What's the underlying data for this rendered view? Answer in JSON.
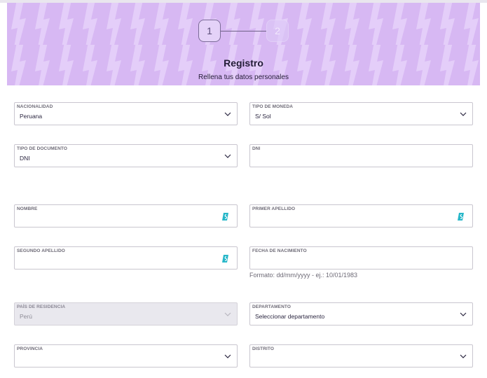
{
  "header": {
    "steps": [
      {
        "number": "1",
        "state": "active"
      },
      {
        "number": "2",
        "state": "inactive"
      }
    ],
    "title": "Registro",
    "subtitle": "Rellena tus datos personales",
    "background_color": "#d7b8f3"
  },
  "form": {
    "nacionalidad": {
      "label": "NACIONALIDAD",
      "value": "Peruana"
    },
    "tipo_moneda": {
      "label": "TIPO DE MONEDA",
      "value": "S/ Sol"
    },
    "tipo_documento": {
      "label": "TIPO DE DOCUMENTO",
      "value": "DNI"
    },
    "dni": {
      "label": "DNI",
      "value": ""
    },
    "nombre": {
      "label": "NOMBRE",
      "value": ""
    },
    "primer_apellido": {
      "label": "PRIMER APELLIDO",
      "value": ""
    },
    "segundo_apellido": {
      "label": "SEGUNDO APELLIDO",
      "value": ""
    },
    "fecha_nacimiento": {
      "label": "FECHA DE NACIMIENTO",
      "value": "",
      "hint": "Formato: dd/mm/yyyy - ej.: 10/01/1983"
    },
    "pais_residencia": {
      "label": "PAÍS DE RESIDENCIA",
      "value": "Perú",
      "disabled": true
    },
    "departamento": {
      "label": "DEPARTAMENTO",
      "value": "Seleccionar departamento"
    },
    "provincia": {
      "label": "PROVINCIA",
      "value": ""
    },
    "distrito": {
      "label": "DISTRITO",
      "value": ""
    }
  },
  "icons": {
    "dropdown": "chevron-down-icon",
    "autofill": "autofill-extension-icon"
  },
  "colors": {
    "autofill_icon": "#27b7c9",
    "border": "#c9c6cf",
    "disabled_bg": "#e9e8ee"
  }
}
